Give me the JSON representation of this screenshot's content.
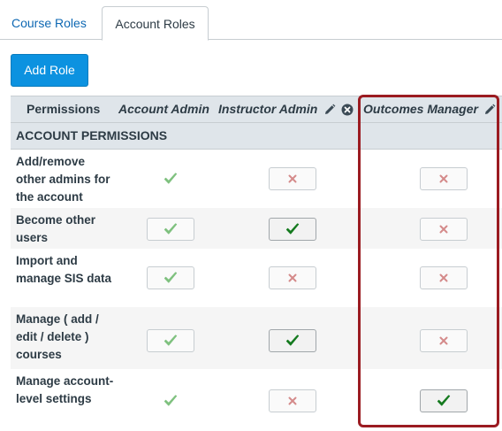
{
  "tabs": [
    {
      "label": "Course Roles"
    },
    {
      "label": "Account Roles"
    }
  ],
  "add_role_label": "Add Role",
  "table": {
    "permissions_header": "Permissions",
    "roles": [
      {
        "label": "Account Admin"
      },
      {
        "label": "Instructor Admin"
      },
      {
        "label": "Outcomes Manager"
      }
    ],
    "section_label": "ACCOUNT PERMISSIONS",
    "rows": [
      {
        "label": "Add/remove other admins for the account",
        "states": [
          "check-light",
          "x",
          "x"
        ]
      },
      {
        "label": "Become other users",
        "states": [
          "check-light-box",
          "check",
          "x"
        ]
      },
      {
        "label": "Import and manage SIS data",
        "states": [
          "check-light-box",
          "x",
          "x"
        ]
      },
      {
        "label": "Manage ( add / edit / delete ) courses",
        "states": [
          "check-light-box",
          "check",
          "x"
        ]
      },
      {
        "label": "Manage account-level settings",
        "states": [
          "check-light",
          "x",
          "check"
        ]
      }
    ]
  },
  "colors": {
    "link": "#0e68b3",
    "button": "#0c92e0",
    "header_bg": "#dfe5ea",
    "check_light": "#7fc17f",
    "check_dark": "#157a1f",
    "x_light": "#d48a8a",
    "highlight": "#9b1b21"
  },
  "icons": {
    "edit": "pencil-icon",
    "remove": "close-circle-icon",
    "granted": "check-icon",
    "denied": "x-icon"
  }
}
